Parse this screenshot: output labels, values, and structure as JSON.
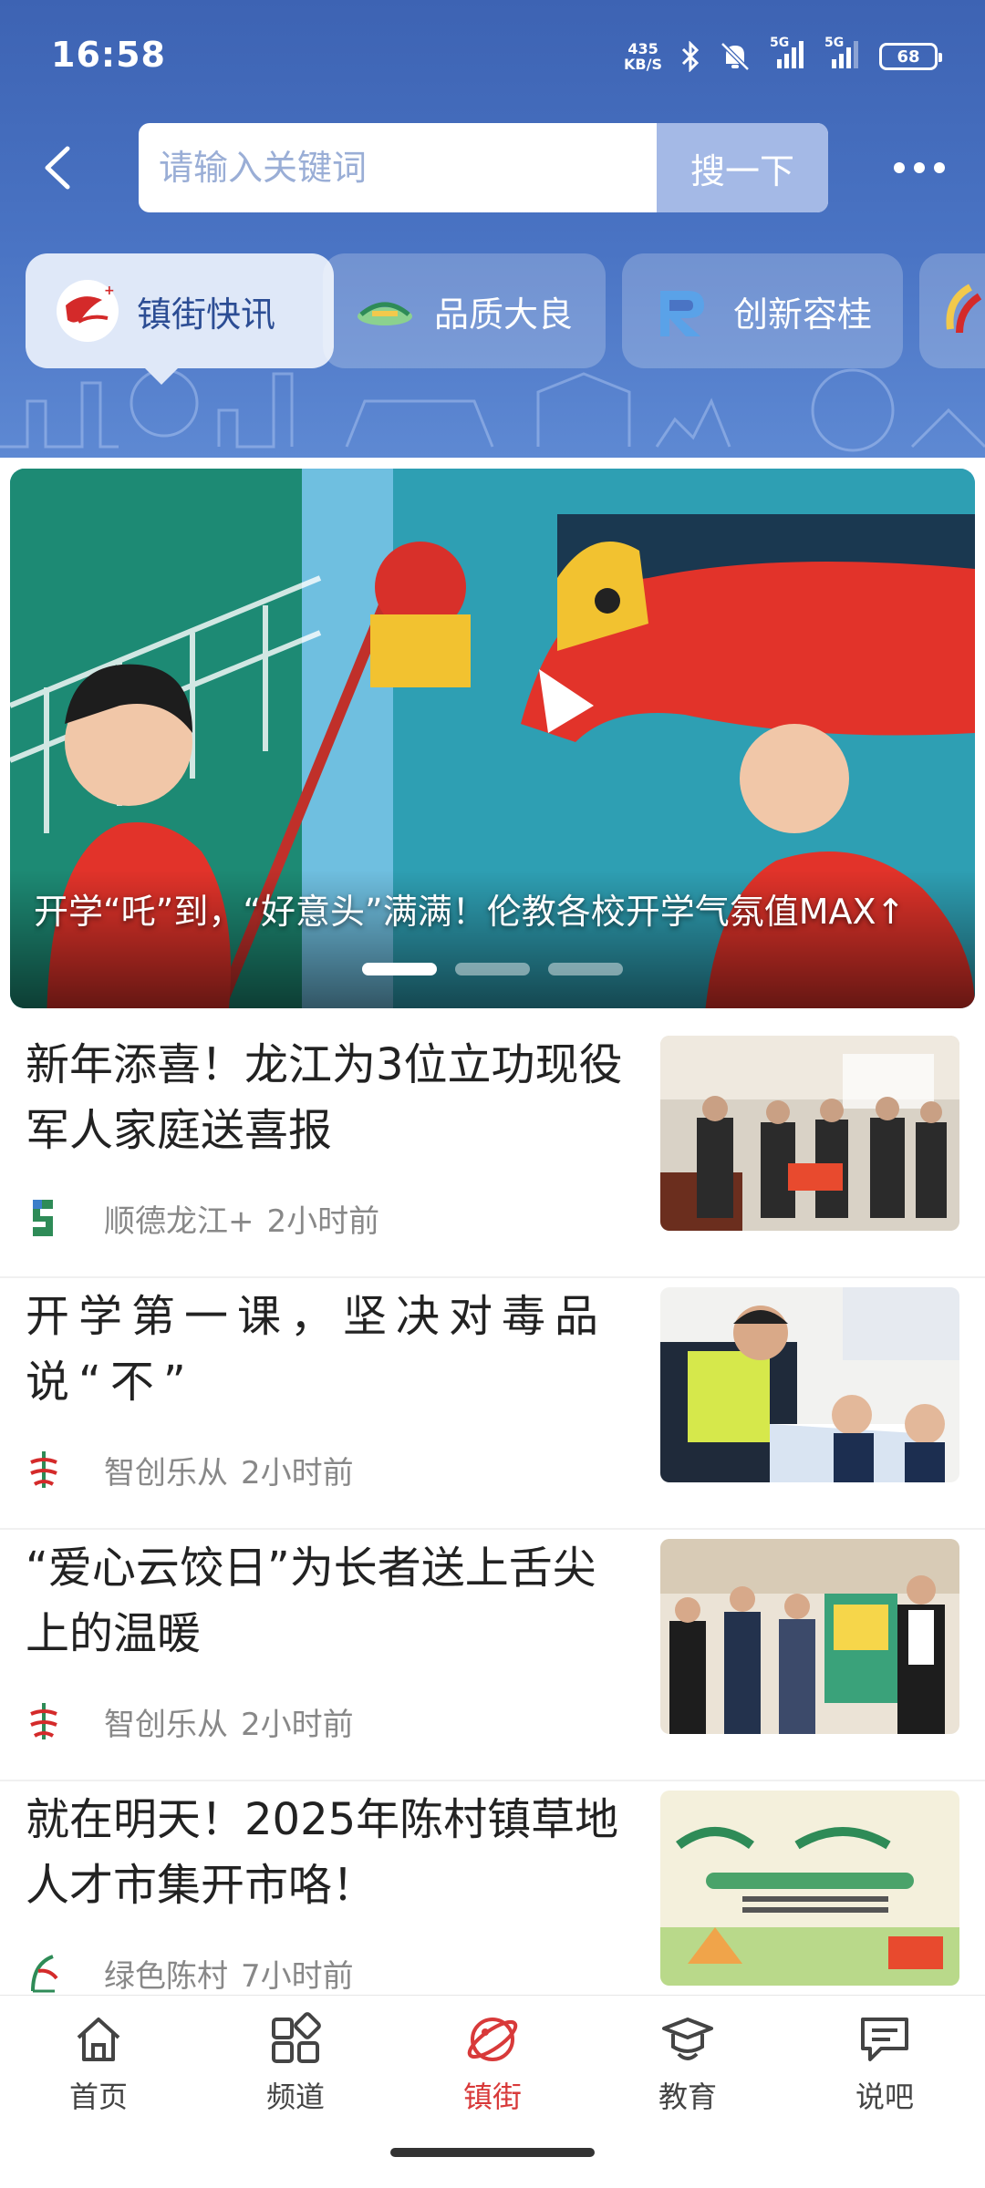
{
  "status_bar": {
    "time": "16:58",
    "net_speed_value": "435",
    "net_speed_unit": "KB/S",
    "network_1": "5G",
    "network_2": "5G",
    "battery": "68"
  },
  "search": {
    "placeholder": "请输入关键词",
    "button_label": "搜一下"
  },
  "channels": [
    {
      "label": "镇街快讯",
      "icon": "shunde-logo-icon",
      "active": true
    },
    {
      "label": "品质大良",
      "icon": "daliang-logo-icon",
      "active": false
    },
    {
      "label": "创新容桂",
      "icon": "ronggui-logo-icon",
      "active": false
    }
  ],
  "banner": {
    "title": "开学“吒”到，“好意头”满满！伦教各校开学气氛值MAX↑",
    "slides": 3,
    "active_slide": 1
  },
  "news": [
    {
      "title": "新年添喜！龙江为3位立功现役军人家庭送喜报",
      "source": "顺德龙江+",
      "time": "2小时前"
    },
    {
      "title": "开学第一课，坚决对毒品说“不”",
      "source": "智创乐从",
      "time": "2小时前"
    },
    {
      "title": "“爱心云饺日”为长者送上舌尖上的温暖",
      "source": "智创乐从",
      "time": "2小时前"
    },
    {
      "title": "就在明天！2025年陈村镇草地人才市集开市咯！",
      "source": "绿色陈村",
      "time": "7小时前"
    }
  ],
  "bottom_nav": [
    {
      "label": "首页",
      "icon": "home-icon",
      "active": false
    },
    {
      "label": "频道",
      "icon": "channels-grid-icon",
      "active": false
    },
    {
      "label": "镇街",
      "icon": "planet-icon",
      "active": true
    },
    {
      "label": "教育",
      "icon": "graduation-cap-icon",
      "active": false
    },
    {
      "label": "说吧",
      "icon": "chat-bubble-icon",
      "active": false
    }
  ],
  "colors": {
    "header_blue": "#4a74c4",
    "active_nav_red": "#d83a3a",
    "search_button": "#a4b9e6"
  }
}
